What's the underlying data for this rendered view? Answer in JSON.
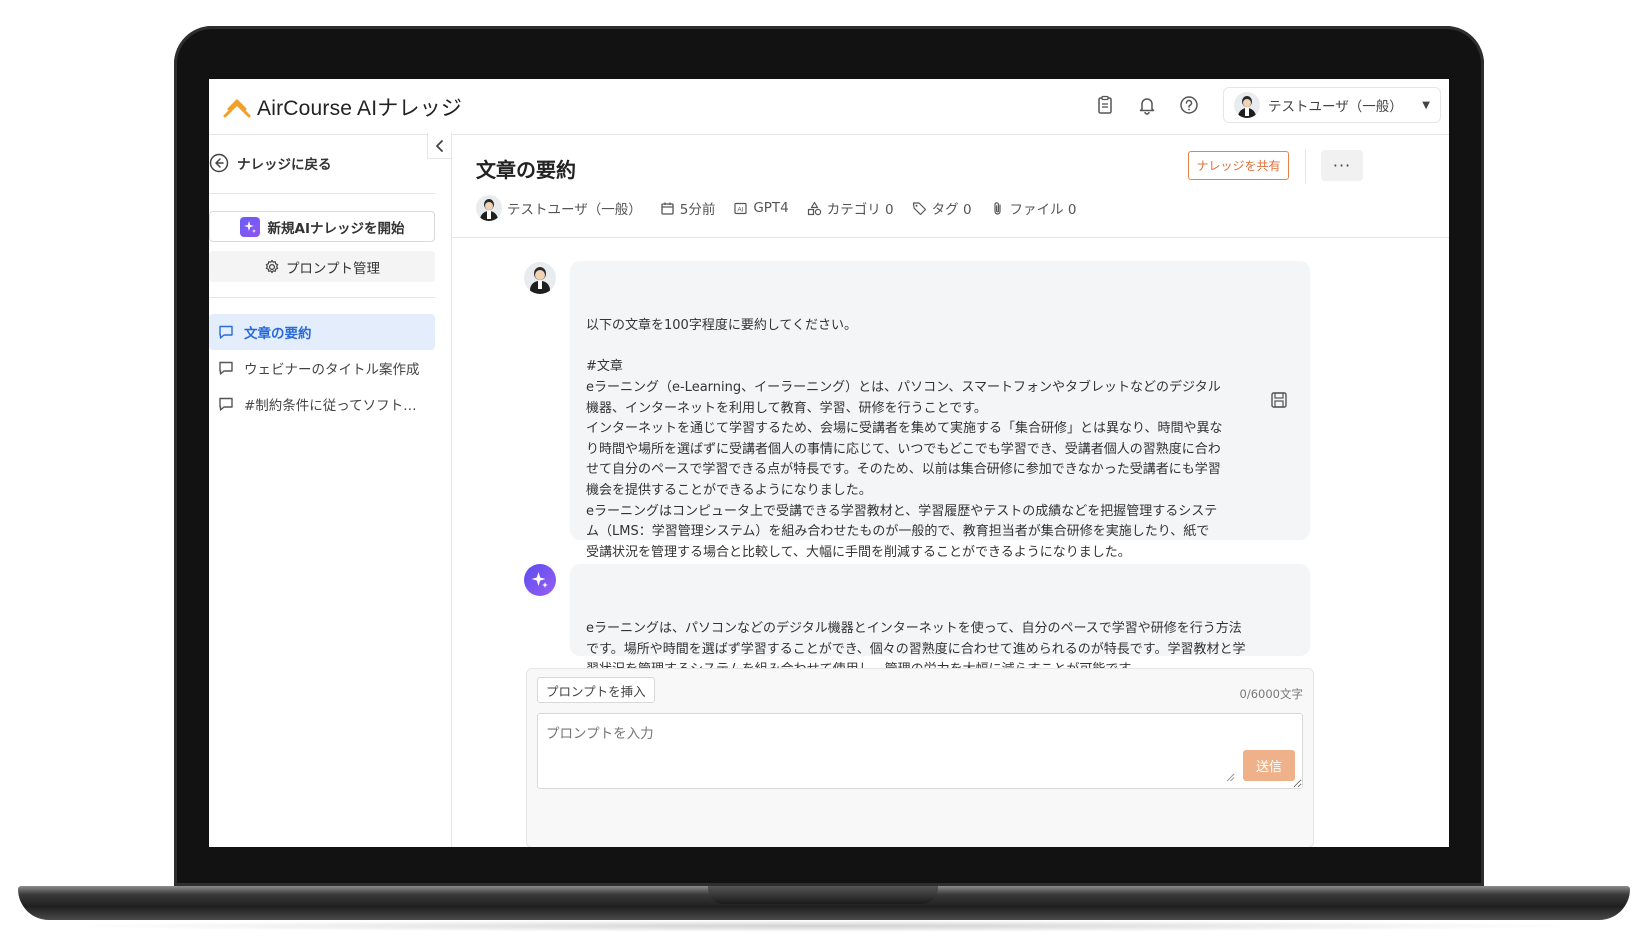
{
  "app": {
    "brand": "AirCourse AIナレッジ",
    "brand_color": "#f2a02c"
  },
  "header": {
    "icons": [
      "clipboard-icon",
      "bell-icon",
      "help-icon"
    ],
    "user_name": "テストユーザ（一般）"
  },
  "sidebar": {
    "back_label": "ナレッジに戻る",
    "new_button": "新規AIナレッジを開始",
    "prompt_mgmt": "プロンプト管理",
    "conversations": [
      {
        "label": "文章の要約",
        "active": true
      },
      {
        "label": "ウェビナーのタイトル案作成",
        "active": false
      },
      {
        "label": "#制約条件に従ってソフト…",
        "active": false
      }
    ]
  },
  "main": {
    "title": "文章の要約",
    "share_button": "ナレッジを共有",
    "more_button": "···",
    "meta": {
      "user": "テストユーザ（一般）",
      "time": "5分前",
      "model": "GPT4",
      "category": "カテゴリ 0",
      "tags": "タグ 0",
      "files": "ファイル 0"
    },
    "messages": [
      {
        "role": "user",
        "lines": [
          "以下の文章を100字程度に要約してください。",
          "",
          "#文章",
          "eラーニング（e-Learning、イーラーニング）とは、パソコン、スマートフォンやタブレットなどのデジタル",
          "機器、インターネットを利用して教育、学習、研修を行うことです。",
          "インターネットを通じて学習するため、会場に受講者を集めて実施する「集合研修」とは異なり、時間や異な",
          "り時間や場所を選ばずに受講者個人の事情に応じて、いつでもどこでも学習でき、受講者個人の習熟度に合わ",
          "せて自分のペースで学習できる点が特長です。そのため、以前は集合研修に参加できなかった受講者にも学習",
          "機会を提供することができるようになりました。",
          "eラーニングはコンピュータ上で受講できる学習教材と、学習履歴やテストの成績などを把握管理するシステ",
          "ム（LMS：学習管理システム）を組み合わせたものが一般的で、教育担当者が集合研修を実施したり、紙で",
          "受講状況を管理する場合と比較して、大幅に手間を削減することができるようになりました。"
        ]
      },
      {
        "role": "assistant",
        "lines": [
          "eラーニングは、パソコンなどのデジタル機器とインターネットを使って、自分のペースで学習や研修を行う方法",
          "です。場所や時間を選ばず学習することができ、個々の習熟度に合わせて進められるのが特長です。学習教材と学",
          "習状況を管理するシステムを組み合わせて使用し、管理の労力を大幅に減らすことが可能です。"
        ]
      }
    ]
  },
  "composer": {
    "insert_button": "プロンプトを挿入",
    "char_count": "0/6000文字",
    "placeholder": "プロンプトを入力",
    "send_button": "送信"
  },
  "colors": {
    "accent_orange": "#e0703a",
    "active_blue": "#2a6ad8",
    "ai_purple": "#6a5cf5"
  }
}
